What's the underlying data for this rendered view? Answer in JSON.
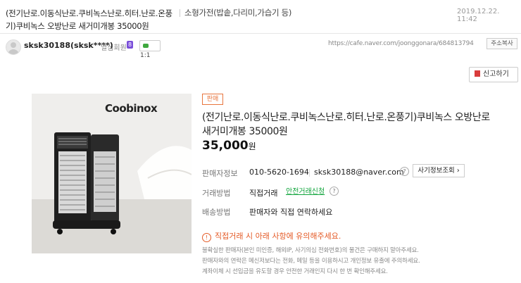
{
  "post": {
    "title": "(전기난로.이동식난로.쿠비녹스난로.히터.난로.온풍기)쿠비녹스 오방난로 새거미개봉 35000원",
    "category": "소형가전(밥솥,다리미,가습기 등)",
    "date": "2019.12.22. 11:42"
  },
  "author": {
    "nickname": "sksk30188(sksk****)",
    "level": "열심회원",
    "level_badge": "8",
    "chat_count": "1:1",
    "url": "https://cafe.naver.com/joonggonara/684813794",
    "copy_label": "주소복사"
  },
  "report_label": "신고하기",
  "product": {
    "image_brand": "Coobinox",
    "sale_badge": "판매",
    "title": "(전기난로.이동식난로.쿠비녹스난로.히터.난로.온풍기)쿠비녹스 오방난로 새거미개봉 35000원",
    "price": "35,000",
    "currency": "원"
  },
  "seller": {
    "label": "판매자정보",
    "phone": "010-5620-1694",
    "email": "sksk30188@naver.com",
    "fraud_check": "사기정보조회"
  },
  "trade": {
    "label": "거래방법",
    "method": "직접거래",
    "safe_link": "안전거래신청"
  },
  "delivery": {
    "label": "배송방법",
    "value": "판매자와 직접 연락하세요"
  },
  "warning": "직접거래 시 아래 사항에 유의해주세요.",
  "notes": [
    "불확실한 판매자(본인 미인증, 해외IP, 사기의심 전화번호)의 물건은 구매하지 말아주세요.",
    "판매자와의 연락은 메신저보다는 전화, 메일 등을 이용하시고 개인정보 유출에 주의하세요.",
    "계좌이체 시 선입금을 유도할 경우 안전한 거래인지 다시 한 번 확인해주세요."
  ]
}
